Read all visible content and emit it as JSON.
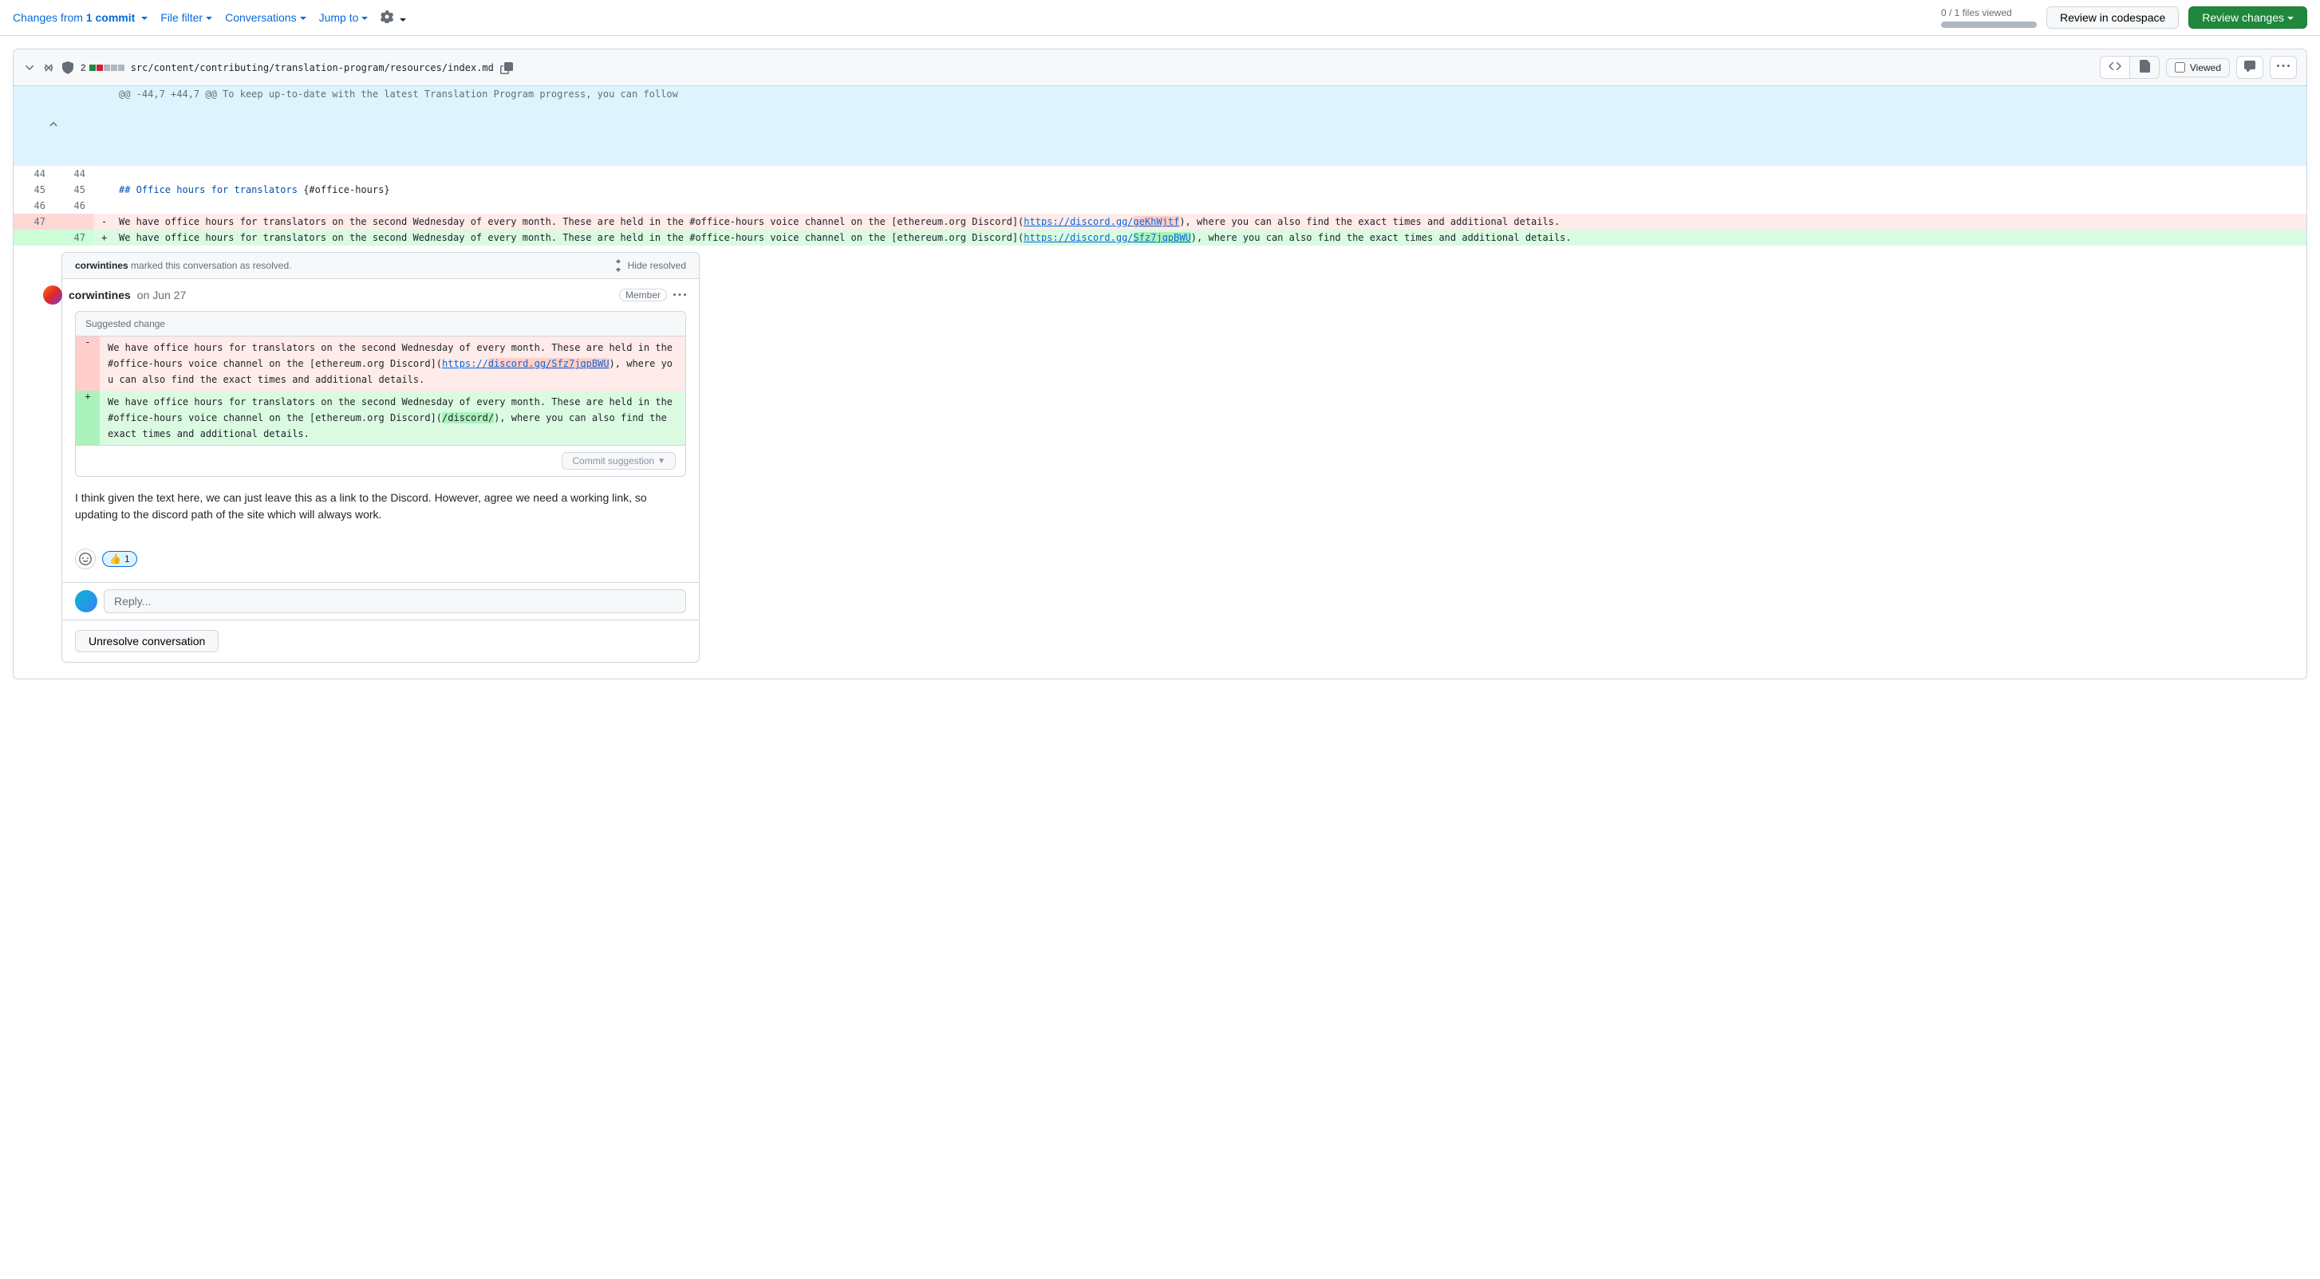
{
  "toolbar": {
    "changes_from": "Changes from",
    "commit_count": "1 commit",
    "file_filter": "File filter",
    "conversations": "Conversations",
    "jump_to": "Jump to",
    "files_viewed": "0 / 1 files viewed",
    "review_codespace": "Review in codespace",
    "review_changes": "Review changes"
  },
  "file": {
    "diff_count": "2",
    "path": "src/content/contributing/translation-program/resources/index.md",
    "viewed_label": "Viewed"
  },
  "hunk": {
    "header": "@@ -44,7 +44,7 @@ To keep up-to-date with the latest Translation Program progress, you can follow",
    "lines": [
      {
        "old": "44",
        "new": "44",
        "type": "context",
        "content": ""
      },
      {
        "old": "45",
        "new": "45",
        "type": "context",
        "content_prefix": "## Office hours for translators ",
        "content_anchor": "{#office-hours}"
      },
      {
        "old": "46",
        "new": "46",
        "type": "context",
        "content": ""
      },
      {
        "old": "47",
        "new": "",
        "type": "del",
        "text_pre": "We have office hours for translators on the second Wednesday of every month. These are held in the #office-hours voice channel on the [ethereum.org Discord](",
        "link": "https://discord.gg/",
        "highlight": "geKhWjtf",
        "text_post": "), where you can also find the exact times and additional details."
      },
      {
        "old": "",
        "new": "47",
        "type": "add",
        "text_pre": "We have office hours for translators on the second Wednesday of every month. These are held in the #office-hours voice channel on the [ethereum.org Discord](",
        "link": "https://discord.gg/",
        "highlight": "Sfz7jqpBWU",
        "text_post": "), where you can also find the exact times and additional details."
      }
    ]
  },
  "conversation": {
    "resolved_by": "corwintines",
    "resolved_text": " marked this conversation as resolved.",
    "hide_resolved": "Hide resolved",
    "comment": {
      "author": "corwintines",
      "time": "on Jun 27",
      "badge": "Member",
      "suggestion_label": "Suggested change",
      "sug_del_pre": "We have office hours for translators on the second Wednesday of every month. These are held in the #office-hours voice channel on the [ethereum.org Discord](",
      "sug_del_link_pre": "https://",
      "sug_del_highlight": "discord.gg/Sfz7jqpBWU",
      "sug_del_post": "), where you can also find the exact times and additional details.",
      "sug_add_pre": "We have office hours for translators on the second Wednesday of every month. These are held in the #office-hours voice channel on the [ethereum.org Discord](",
      "sug_add_highlight": "/discord/",
      "sug_add_post": "), where you can also find the exact times and additional details.",
      "commit_suggestion": "Commit suggestion",
      "body": "I think given the text here, we can just leave this as a link to the Discord. However, agree we need a working link, so updating to the discord path of the site which will always work."
    },
    "reaction_emoji": "👍",
    "reaction_count": "1",
    "reply_placeholder": "Reply...",
    "unresolve": "Unresolve conversation"
  }
}
